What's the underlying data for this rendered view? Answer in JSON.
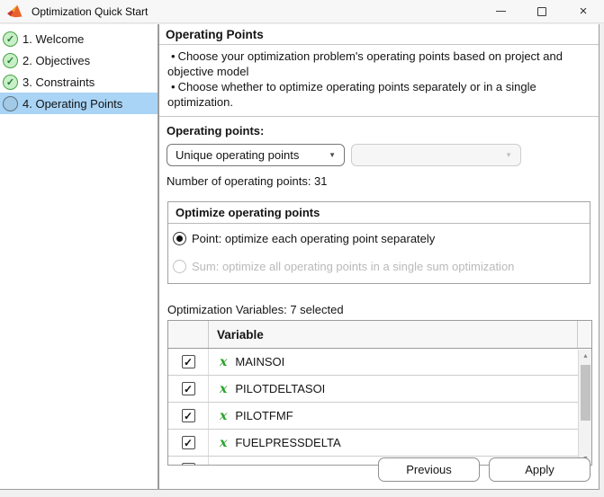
{
  "window": {
    "title": "Optimization Quick Start"
  },
  "icons": {
    "check": "✓",
    "bullet": "•",
    "dropdown_caret": "▼",
    "scroll_up": "▲",
    "scroll_down": "▼",
    "variable_x": "x",
    "close": "×"
  },
  "colors": {
    "selected_step_bg": "#a9d4f5",
    "step_done_fill": "#c9efc9",
    "step_done_border": "#44a344",
    "variable_x_green": "#2ba12b",
    "panel_border": "#9b9b9b",
    "matlab_orange": "#e8632a",
    "matlab_red": "#c7372f"
  },
  "sidebar": {
    "items": [
      {
        "label": "1. Welcome",
        "status": "complete"
      },
      {
        "label": "2. Objectives",
        "status": "complete"
      },
      {
        "label": "3. Constraints",
        "status": "complete"
      },
      {
        "label": "4. Operating Points",
        "status": "current"
      }
    ]
  },
  "main": {
    "heading": "Operating Points",
    "bullets": [
      "Choose your optimization problem's operating points based on project and objective model",
      "Choose whether to optimize operating points separately or in a single optimization."
    ],
    "operating_points": {
      "label": "Operating points:",
      "dropdown1_value": "Unique operating points",
      "dropdown2_value": "",
      "count_text": "Number of operating points: 31"
    },
    "optimize_group": {
      "title": "Optimize operating points",
      "options": [
        {
          "label": "Point: optimize each operating point separately",
          "selected": true,
          "enabled": true
        },
        {
          "label": "Sum: optimize all operating points in a single sum optimization",
          "selected": false,
          "enabled": false
        }
      ]
    },
    "variables": {
      "label": "Optimization Variables: 7 selected",
      "column_header": "Variable",
      "rows": [
        {
          "name": "MAINSOI",
          "checked": true
        },
        {
          "name": "PILOTDELTASOI",
          "checked": true
        },
        {
          "name": "PILOTFMF",
          "checked": true
        },
        {
          "name": "FUELPRESSDELTA",
          "checked": true
        },
        {
          "name": "",
          "checked": true
        }
      ]
    },
    "buttons": {
      "previous": "Previous",
      "apply": "Apply"
    }
  }
}
